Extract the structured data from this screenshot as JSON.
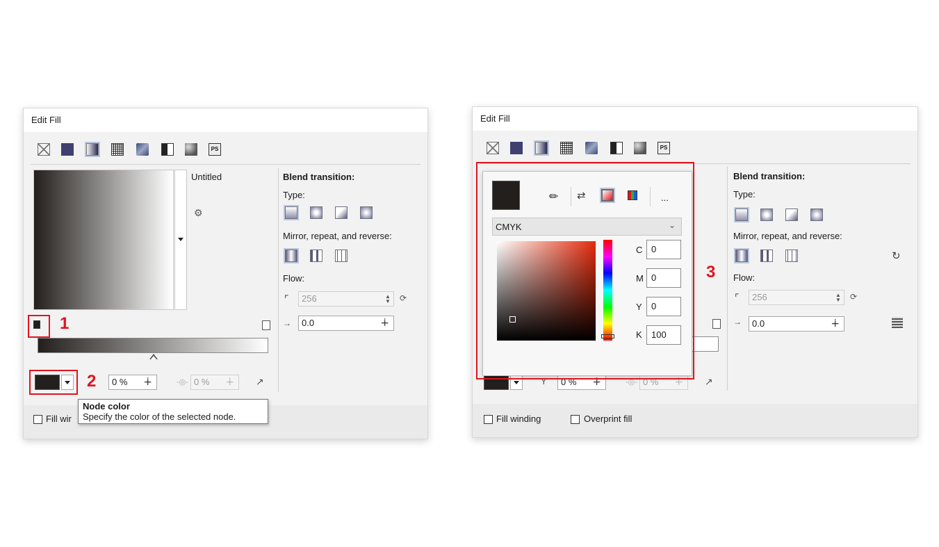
{
  "left": {
    "title": "Edit Fill",
    "preset_name": "Untitled",
    "blend_heading": "Blend transition:",
    "type_label": "Type:",
    "mirror_label": "Mirror, repeat, and reverse:",
    "flow_label": "Flow:",
    "steps_value": "256",
    "acceleration_value": "0.0",
    "transparency_value": "0 %",
    "position_value": "0 %",
    "fill_winding_label": "Fill wir",
    "tooltip": {
      "title": "Node color",
      "body": "Specify the color of the selected node."
    }
  },
  "right": {
    "title": "Edit Fill",
    "blend_heading": "Blend transition:",
    "type_label": "Type:",
    "mirror_label": "Mirror, repeat, and reverse:",
    "flow_label": "Flow:",
    "steps_value": "256",
    "acceleration_value": "0.0",
    "transparency_value": "0 %",
    "position_value": "0 %",
    "fill_winding_label": "Fill winding",
    "overprint_label": "Overprint fill",
    "color_model": "CMYK",
    "more_label": "...",
    "cmyk": [
      {
        "key": "C",
        "value": "0"
      },
      {
        "key": "M",
        "value": "0"
      },
      {
        "key": "Y",
        "value": "0"
      },
      {
        "key": "K",
        "value": "100"
      }
    ]
  },
  "annotations": {
    "one": "1",
    "two": "2",
    "three": "3"
  },
  "colors": {
    "node_color": "#231f1c",
    "highlight": "#e0141e"
  }
}
